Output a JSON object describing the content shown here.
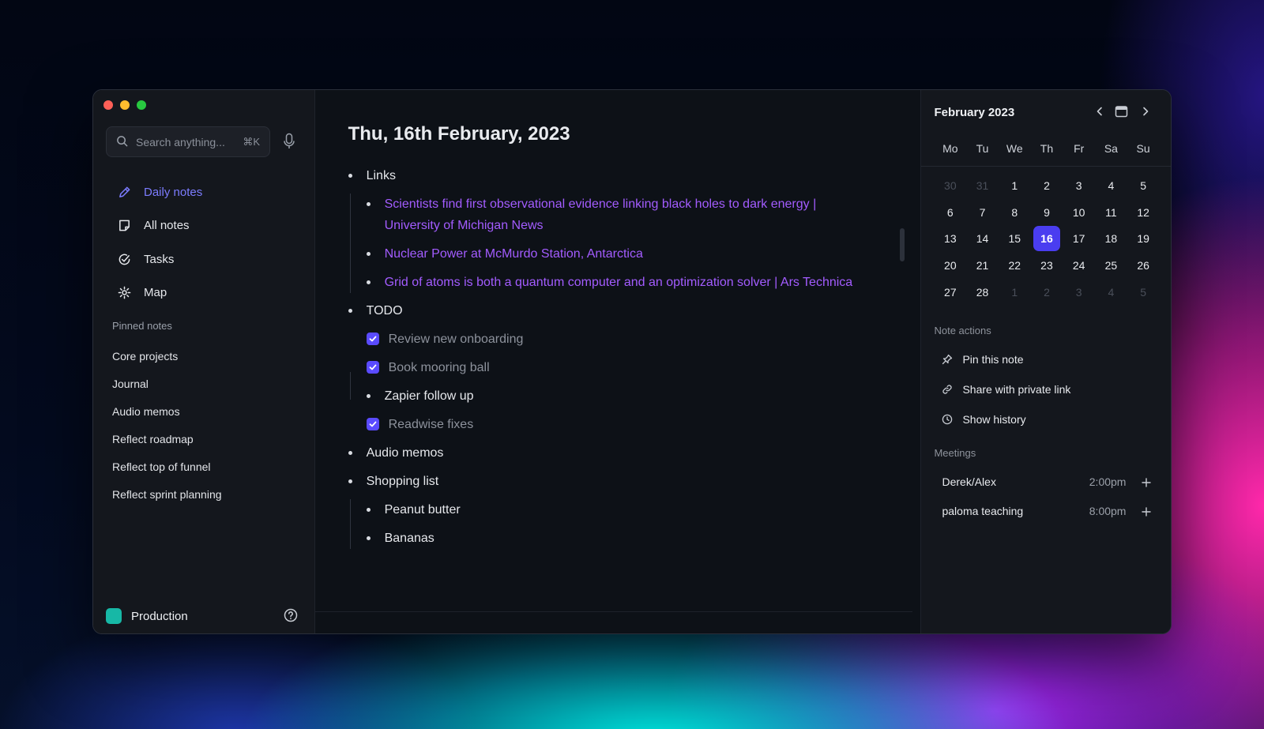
{
  "colors": {
    "accent": "#7c7cff",
    "link": "#a35cff",
    "checkbox": "#5a4bff",
    "selected_day": "#4a3df0",
    "workspace": "#17b8a6",
    "traffic_red": "#fe5f57",
    "traffic_yellow": "#febc2e",
    "traffic_green": "#28c840"
  },
  "search": {
    "placeholder": "Search anything...",
    "shortcut": "⌘K",
    "icon": "search-icon"
  },
  "nav": [
    {
      "label": "Daily notes",
      "icon": "pencil-icon",
      "active": true
    },
    {
      "label": "All notes",
      "icon": "note-icon",
      "active": false
    },
    {
      "label": "Tasks",
      "icon": "check-circle-icon",
      "active": false
    },
    {
      "label": "Map",
      "icon": "map-icon",
      "active": false
    }
  ],
  "pinned": {
    "title": "Pinned notes",
    "items": [
      "Core projects",
      "Journal",
      "Audio memos",
      "Reflect roadmap",
      "Reflect top of funnel",
      "Reflect sprint planning"
    ]
  },
  "workspace": {
    "name": "Production"
  },
  "note": {
    "title": "Thu, 16th February, 2023",
    "links_label": "Links",
    "links": [
      {
        "text": "Scientists find first observational evidence linking black holes to dark energy | University of Michigan News"
      },
      {
        "text": "Nuclear Power at McMurdo Station, Antarctica"
      },
      {
        "text": "Grid of atoms is both a quantum computer and an optimization solver | Ars Technica"
      }
    ],
    "todo_label": "TODO",
    "todo": [
      {
        "text": "Review new onboarding",
        "checked": true
      },
      {
        "text": "Book mooring ball",
        "checked": true
      },
      {
        "text": "Zapier follow up",
        "checked": false
      },
      {
        "text": "Readwise fixes",
        "checked": true
      }
    ],
    "audio_label": "Audio memos",
    "shopping_label": "Shopping list",
    "shopping": [
      "Peanut butter",
      "Bananas"
    ]
  },
  "calendar": {
    "month": "February 2023",
    "dow": [
      "Mo",
      "Tu",
      "We",
      "Th",
      "Fr",
      "Sa",
      "Su"
    ],
    "days": [
      {
        "d": "30",
        "m": true
      },
      {
        "d": "31",
        "m": true
      },
      {
        "d": "1"
      },
      {
        "d": "2"
      },
      {
        "d": "3"
      },
      {
        "d": "4"
      },
      {
        "d": "5"
      },
      {
        "d": "6"
      },
      {
        "d": "7"
      },
      {
        "d": "8"
      },
      {
        "d": "9"
      },
      {
        "d": "10"
      },
      {
        "d": "11"
      },
      {
        "d": "12"
      },
      {
        "d": "13"
      },
      {
        "d": "14"
      },
      {
        "d": "15"
      },
      {
        "d": "16",
        "sel": true
      },
      {
        "d": "17"
      },
      {
        "d": "18"
      },
      {
        "d": "19"
      },
      {
        "d": "20"
      },
      {
        "d": "21"
      },
      {
        "d": "22"
      },
      {
        "d": "23"
      },
      {
        "d": "24"
      },
      {
        "d": "25"
      },
      {
        "d": "26"
      },
      {
        "d": "27"
      },
      {
        "d": "28"
      },
      {
        "d": "1",
        "m": true
      },
      {
        "d": "2",
        "m": true
      },
      {
        "d": "3",
        "m": true
      },
      {
        "d": "4",
        "m": true
      },
      {
        "d": "5",
        "m": true
      }
    ]
  },
  "note_actions": {
    "title": "Note actions",
    "items": [
      {
        "label": "Pin this note",
        "icon": "pin-icon"
      },
      {
        "label": "Share with private link",
        "icon": "link-icon"
      },
      {
        "label": "Show history",
        "icon": "clock-icon"
      }
    ]
  },
  "meetings": {
    "title": "Meetings",
    "items": [
      {
        "name": "Derek/Alex",
        "time": "2:00pm"
      },
      {
        "name": "paloma teaching",
        "time": "8:00pm"
      }
    ]
  }
}
